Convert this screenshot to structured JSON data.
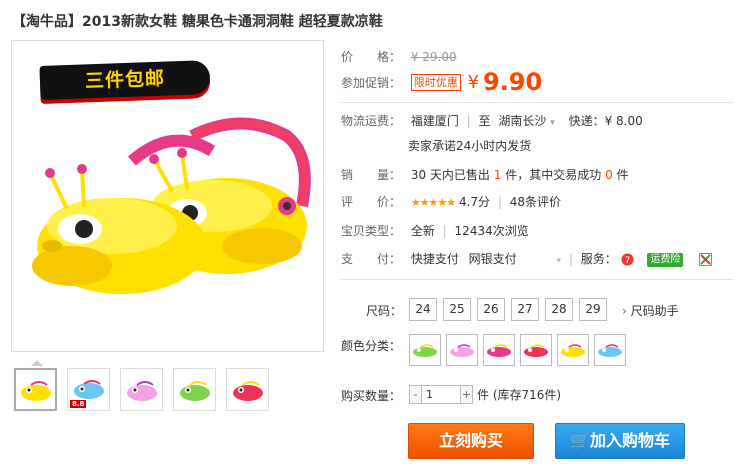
{
  "product": {
    "title": "【淘牛品】2013新款女鞋 糖果色卡通洞洞鞋 超轻夏款凉鞋",
    "promo_banner": "三件包邮"
  },
  "price": {
    "label": "价　　格：",
    "original": "¥ 29.00",
    "promo_label": "参加促销：",
    "promo_badge": "限时优惠",
    "yen": "¥",
    "promo_price": "9.90"
  },
  "shipping": {
    "label": "物流运费：",
    "from": "福建厦门",
    "to_label": "至",
    "to": "湖南长沙",
    "express": "快递：¥ 8.00",
    "promise": "卖家承诺24小时内发货"
  },
  "sales": {
    "label": "销　　量：",
    "prefix": "30 天内已售出",
    "count": "1",
    "mid": "件，其中交易成功",
    "success": "0",
    "suffix": "件"
  },
  "rating": {
    "label": "评　　价：",
    "stars": "★★★★★",
    "score": "4.7分",
    "reviews": "48条评价"
  },
  "type": {
    "label": "宝贝类型：",
    "condition": "全新",
    "views": "12434次浏览"
  },
  "payment": {
    "label": "支　　付：",
    "method1": "快捷支付",
    "method2": "网银支付",
    "service_label": "服务：",
    "insurance": "运费险"
  },
  "size": {
    "label": "尺码：",
    "options": [
      "24",
      "25",
      "26",
      "27",
      "28",
      "29"
    ],
    "guide": "尺码助手"
  },
  "color": {
    "label": "颜色分类："
  },
  "quantity": {
    "label": "购买数量：",
    "minus": "-",
    "value": "1",
    "plus": "+",
    "stock": "件 (库存716件)"
  },
  "actions": {
    "buy": "立刻购买",
    "cart": "加入购物车"
  },
  "thumb_badge": "8.8",
  "colors_hex": {
    "yellow": "#ffe000",
    "blue": "#6cc6f0",
    "pink": "#f2a0e8",
    "green": "#7ed44a",
    "red": "#f0325a",
    "magenta": "#e8388a",
    "accent": "#ff4400"
  }
}
